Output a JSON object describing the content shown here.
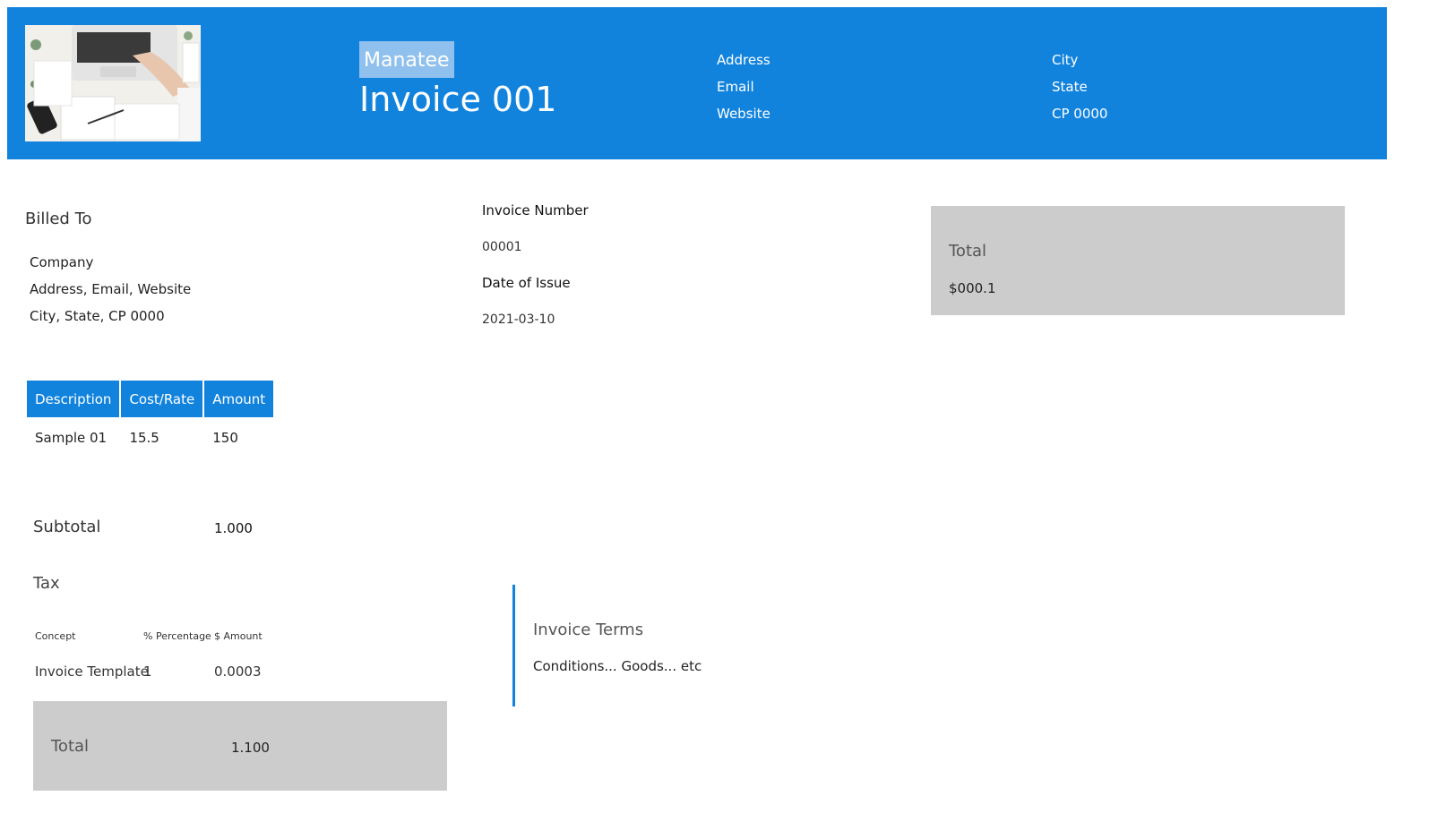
{
  "header": {
    "brand": "Manatee",
    "title": "Invoice 001",
    "contact_left": [
      "Address",
      "Email",
      "Website"
    ],
    "contact_right": [
      "City",
      "State",
      "CP 0000"
    ]
  },
  "billed_to": {
    "title": "Billed To",
    "lines": [
      "Company",
      "Address, Email, Website",
      "City, State, CP 0000"
    ]
  },
  "invoice_details": {
    "number_label": "Invoice Number",
    "number_value": "00001",
    "date_label": "Date of Issue",
    "date_value": "2021-03-10"
  },
  "total_summary": {
    "label": "Total",
    "value": "$000.1"
  },
  "items_table": {
    "headers": [
      "Description",
      "Cost/Rate",
      "Amount"
    ],
    "rows": [
      [
        "Sample 01",
        "15.5",
        "150"
      ]
    ]
  },
  "subtotal": {
    "label": "Subtotal",
    "value": "1.000"
  },
  "tax": {
    "label": "Tax",
    "headers": [
      "Concept",
      "% Percentage",
      "$ Amount"
    ],
    "row": [
      "Invoice Template",
      "1",
      "0.0003"
    ]
  },
  "bottom_total": {
    "label": "Total",
    "value": "1.100"
  },
  "terms": {
    "title": "Invoice Terms",
    "body": "Conditions... Goods... etc"
  },
  "colors": {
    "primary": "#1283dd",
    "box_gray": "#cccccc"
  }
}
